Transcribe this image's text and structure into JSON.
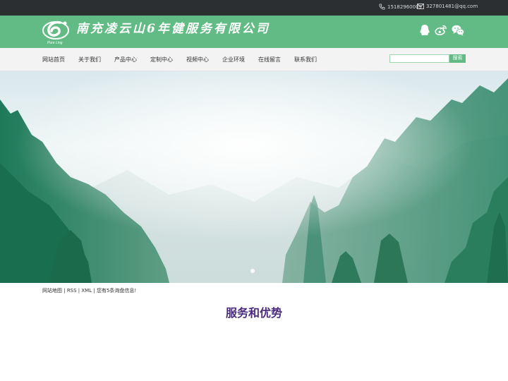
{
  "topbar": {
    "phone": "15182960009",
    "email": "327801481@qq.com",
    "phone_icon": "phone-icon",
    "email_icon": "mail-icon"
  },
  "header": {
    "brand": "南充凌云山6年健服务有限公司",
    "logo_icon": "six-logo-icon",
    "social": [
      "qq-icon",
      "weibo-icon",
      "wechat-icon"
    ],
    "accent_color": "#62bb85"
  },
  "nav": {
    "items": [
      {
        "label": "网站首页"
      },
      {
        "label": "关于我们"
      },
      {
        "label": "产品中心"
      },
      {
        "label": "定制中心"
      },
      {
        "label": "视频中心"
      },
      {
        "label": "企业环境"
      },
      {
        "label": "在线留言"
      },
      {
        "label": "联系我们"
      }
    ],
    "search_button": "搜索"
  },
  "footer_links": {
    "sitemap": "网站地图",
    "sep1": " | ",
    "rss": "RSS",
    "sep2": " | ",
    "xml": "XML",
    "sep3": " | ",
    "notice": "您有5条询盘信息!"
  },
  "section": {
    "title": "服务和优势",
    "title_color": "#4a2b7c"
  }
}
